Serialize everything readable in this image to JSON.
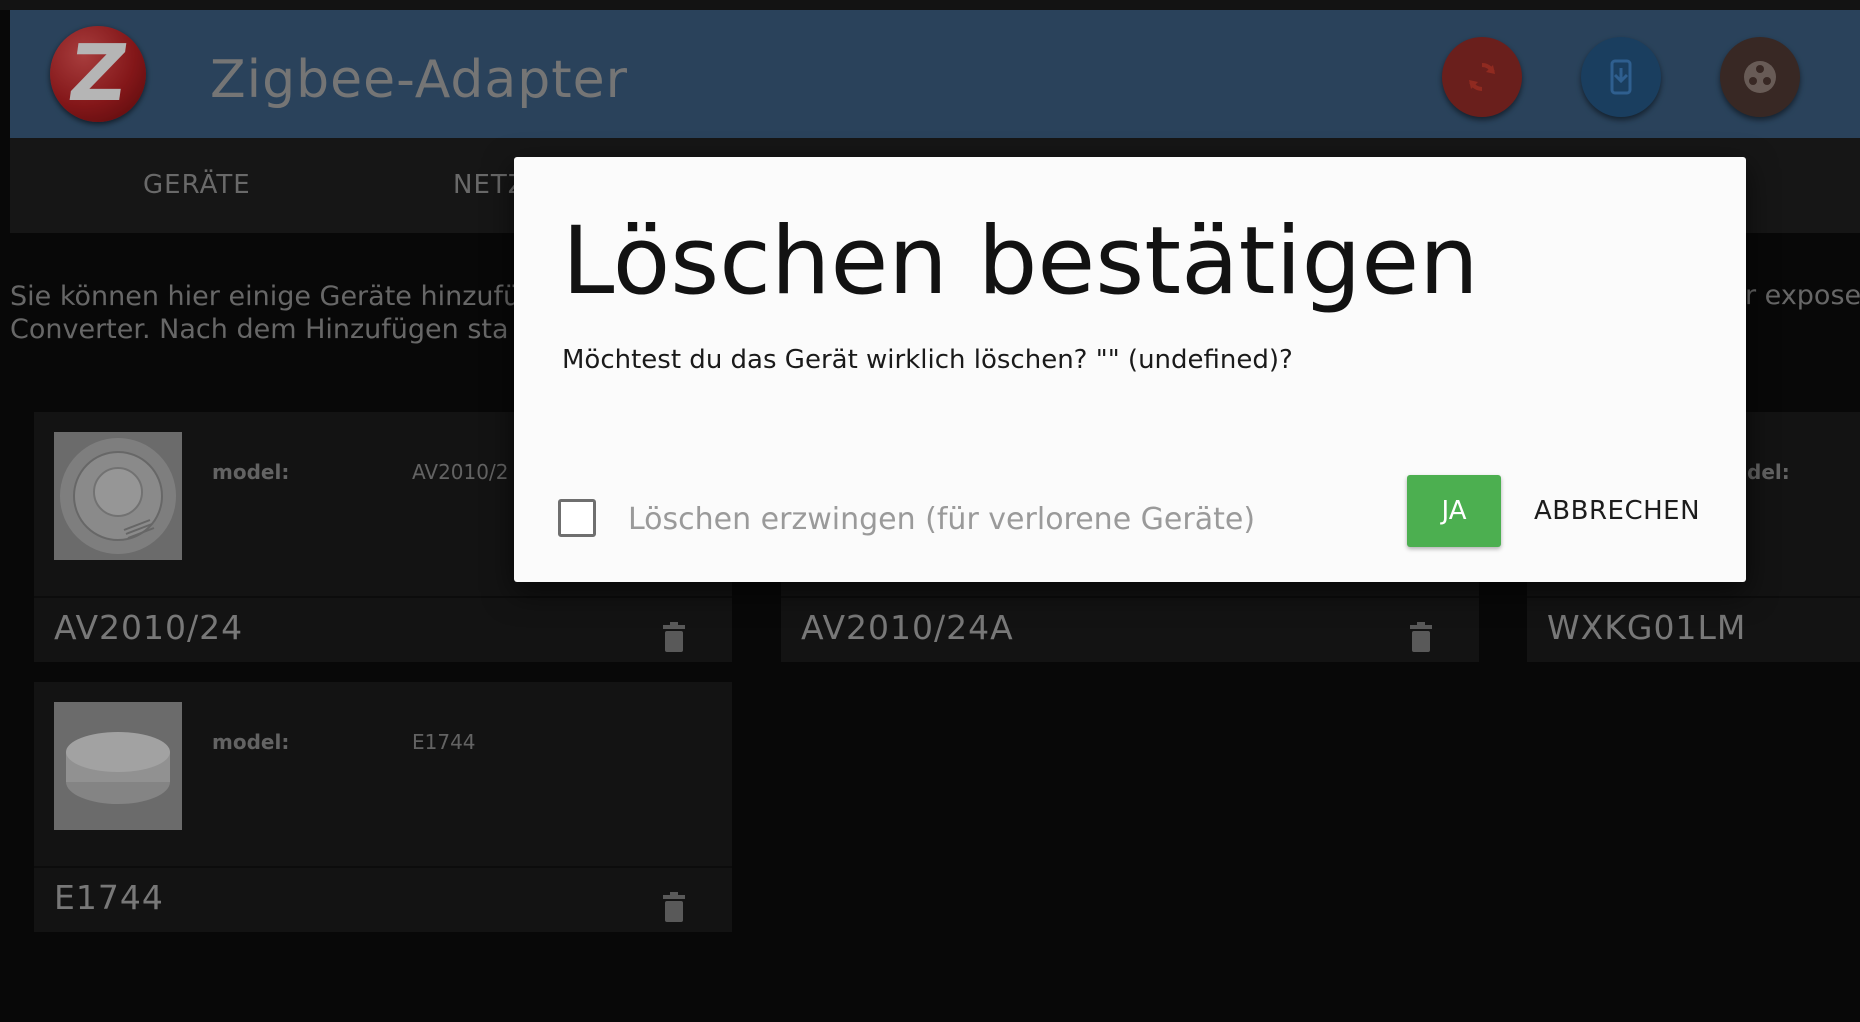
{
  "header": {
    "title": "Zigbee-Adapter",
    "logo_letter": "Z",
    "buttons": [
      {
        "name": "refresh",
        "icon": "refresh-icon",
        "color": "#8e2a26"
      },
      {
        "name": "install-device",
        "icon": "phone-download-icon",
        "color": "#23537f"
      },
      {
        "name": "menu",
        "icon": "dots-circle-icon",
        "color": "#4b3630"
      }
    ]
  },
  "tabs": [
    {
      "label": "GERÄTE"
    },
    {
      "label": "NETZ"
    }
  ],
  "info": {
    "line1": "Sie können hier einige Geräte hinzufü",
    "line2": "Converter. Nach dem Hinzufügen sta",
    "right": "r expose"
  },
  "devices": [
    {
      "model_label": "model:",
      "model_value": "AV2010/2",
      "name": "AV2010/24"
    },
    {
      "name": "AV2010/24A"
    },
    {
      "model_label": "del:",
      "name": "WXKG01LM"
    },
    {
      "model_label": "model:",
      "model_value": "E1744",
      "name": "E1744"
    }
  ],
  "dialog": {
    "title": "Löschen bestätigen",
    "message": "Möchtest du das Gerät wirklich löschen? \"\" (undefined)?",
    "checkbox_label": "Löschen erzwingen (für verlorene Geräte)",
    "checkbox_checked": false,
    "confirm_label": "JA",
    "cancel_label": "ABBRECHEN",
    "confirm_color": "#4caf50"
  }
}
